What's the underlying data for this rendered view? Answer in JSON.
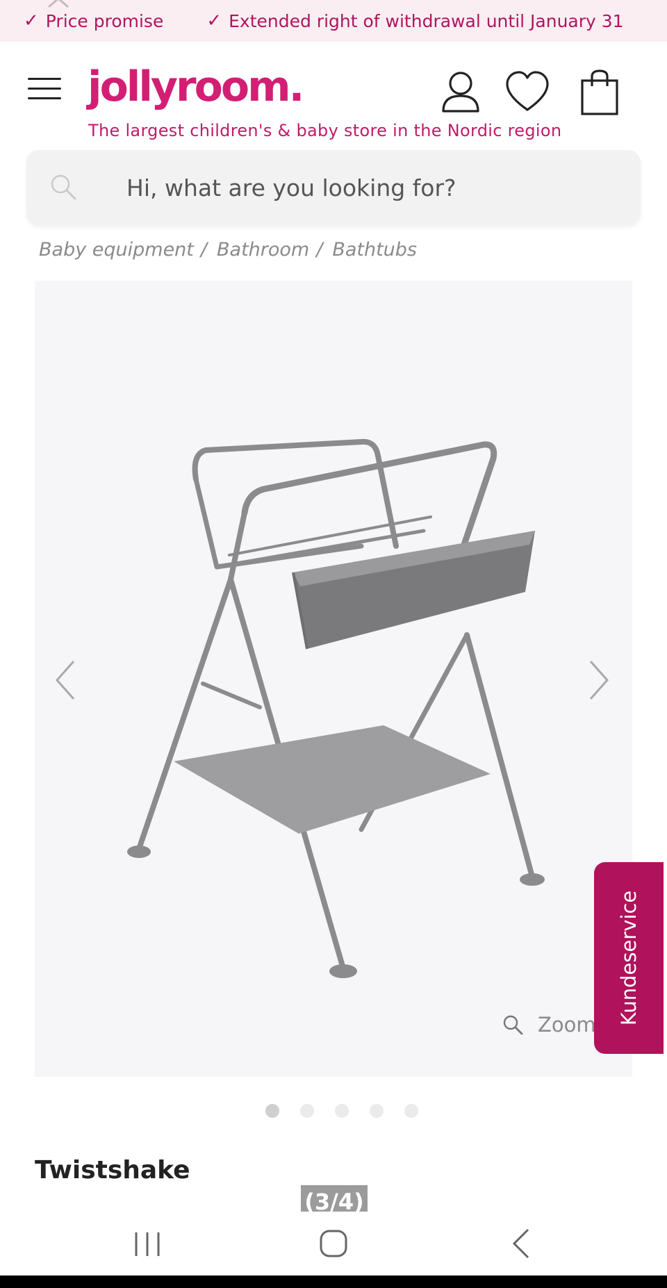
{
  "promo": {
    "items": [
      {
        "check": "✓",
        "label": "Price promise"
      },
      {
        "check": "✓",
        "label": "Extended right of withdrawal until January 31"
      }
    ]
  },
  "header": {
    "logo": "jollyroom.",
    "tagline": "The largest children's & baby store in the Nordic region",
    "icons": [
      "user-icon",
      "heart-icon",
      "bag-icon",
      "menu-icon"
    ]
  },
  "search": {
    "placeholder": "Hi, what are you looking for?"
  },
  "breadcrumb": [
    {
      "label": "Baby equipment"
    },
    {
      "label": "Bathroom"
    },
    {
      "label": "Bathtubs"
    }
  ],
  "breadcrumb_separator": "/",
  "gallery": {
    "zoom_label": "Zoom",
    "dots_count": 5,
    "active_dot": 1
  },
  "support_tab": "Kundeservice",
  "product": {
    "brand": "Twistshake"
  },
  "page_counter": "(3/4)",
  "colors": {
    "brand_pink": "#d21f74",
    "support_magenta": "#b0125b",
    "promo_bg": "#fbeef2"
  }
}
